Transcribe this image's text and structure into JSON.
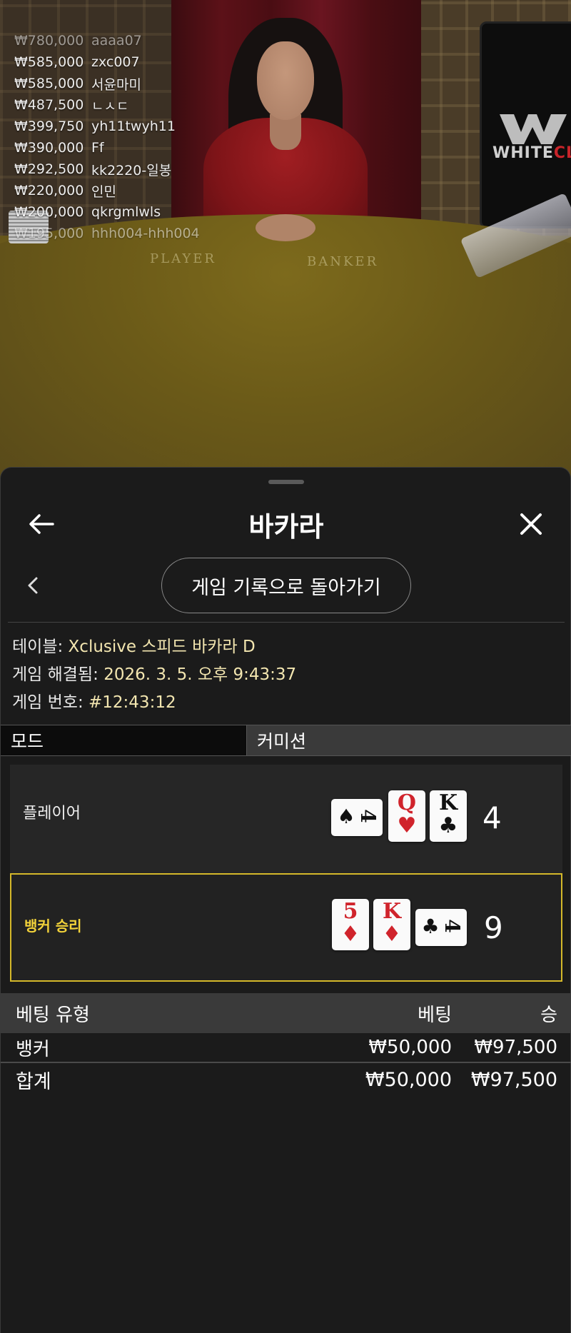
{
  "stream": {
    "monitor_brand_white": "WHITE",
    "monitor_brand_red": "CLIFF",
    "felt_player": "PLAYER",
    "felt_banker": "BANKER",
    "leaderboard": [
      {
        "amount": "₩780,000",
        "user": "aaaa07"
      },
      {
        "amount": "₩585,000",
        "user": "zxc007"
      },
      {
        "amount": "₩585,000",
        "user": "서윤마미"
      },
      {
        "amount": "₩487,500",
        "user": "ㄴㅅㄷ"
      },
      {
        "amount": "₩399,750",
        "user": "yh11twyh11"
      },
      {
        "amount": "₩390,000",
        "user": "Ff"
      },
      {
        "amount": "₩292,500",
        "user": "kk2220-일봉"
      },
      {
        "amount": "₩220,000",
        "user": "인민"
      },
      {
        "amount": "₩200,000",
        "user": "qkrgmlwls"
      },
      {
        "amount": "₩195,000",
        "user": "hhh004-hhh004"
      }
    ]
  },
  "sheet": {
    "title": "바카라",
    "back_icon": "arrow-left-icon",
    "close_icon": "close-icon",
    "return_button": "게임 기록으로 돌아가기",
    "info": {
      "table_label": "테이블:",
      "table_value": "Xclusive 스피드 바카라 D",
      "resolved_label": "게임 해결됨:",
      "resolved_value": "2026. 3. 5. 오후 9:43:37",
      "game_no_label": "게임 번호:",
      "game_no_value": "#12:43:12"
    },
    "tabs": {
      "mode": "모드",
      "commission": "커미션"
    },
    "player": {
      "label": "플레이어",
      "score": "4",
      "cards": [
        {
          "rank": "4",
          "suit": "♠",
          "color": "#111111",
          "orientation": "sideways"
        },
        {
          "rank": "Q",
          "suit": "♥",
          "color": "#d0242c",
          "orientation": "upright"
        },
        {
          "rank": "K",
          "suit": "♣",
          "color": "#111111",
          "orientation": "upright"
        }
      ]
    },
    "banker": {
      "label": "뱅커 승리",
      "score": "9",
      "highlight_color": "#d4b82a",
      "cards": [
        {
          "rank": "5",
          "suit": "♦",
          "color": "#d0242c",
          "orientation": "upright"
        },
        {
          "rank": "K",
          "suit": "♦",
          "color": "#d0242c",
          "orientation": "upright"
        },
        {
          "rank": "4",
          "suit": "♣",
          "color": "#111111",
          "orientation": "sideways"
        }
      ]
    },
    "bets": {
      "headers": {
        "type": "베팅 유형",
        "bet": "베팅",
        "win": "승"
      },
      "rows": [
        {
          "type": "뱅커",
          "bet": "₩50,000",
          "win": "₩97,500"
        }
      ],
      "total": {
        "label": "합계",
        "bet": "₩50,000",
        "win": "₩97,500"
      }
    }
  }
}
